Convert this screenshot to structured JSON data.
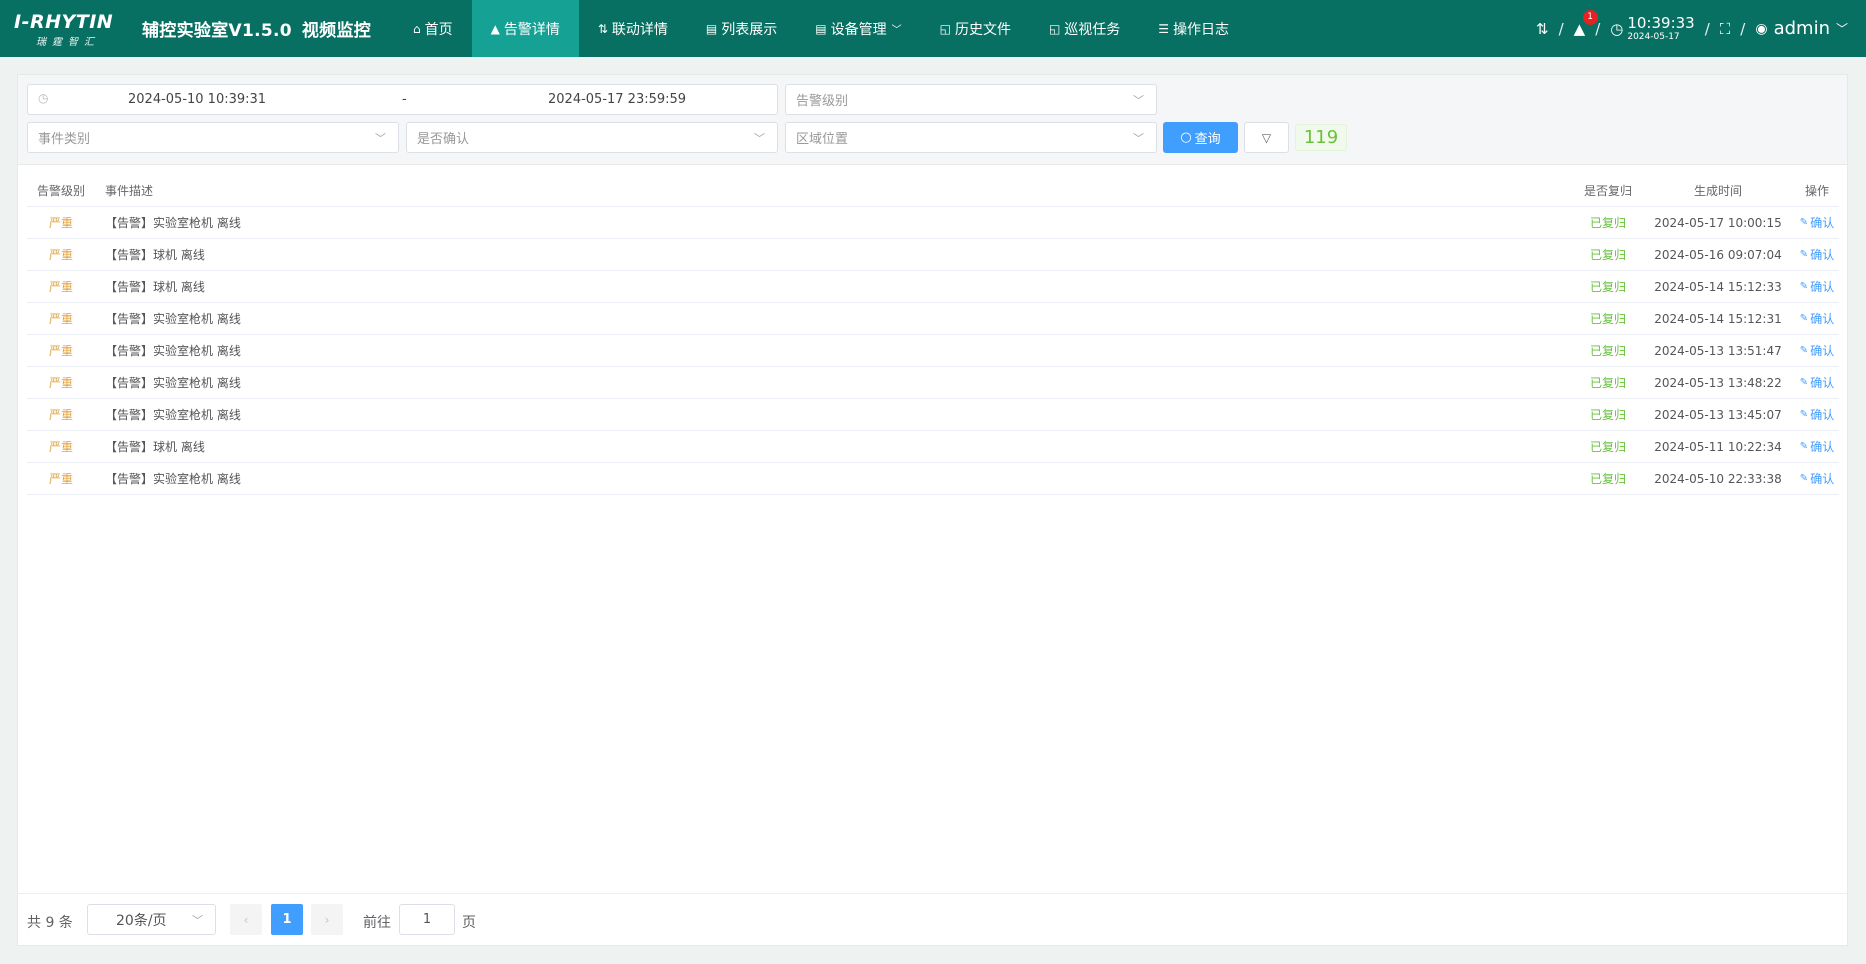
{
  "nav": {
    "logo_main": "I-RHYTIN",
    "logo_sub": "瑞霆智汇",
    "app_title": "辅控实验室V1.5.0",
    "app_subtitle": "视频监控",
    "items": [
      {
        "label": "首页",
        "icon": "home-icon",
        "glyph": "⌂"
      },
      {
        "label": "告警详情",
        "icon": "warning-icon",
        "glyph": "▲"
      },
      {
        "label": "联动详情",
        "icon": "link-icon",
        "glyph": "⇅"
      },
      {
        "label": "列表展示",
        "icon": "list-icon",
        "glyph": "▤"
      },
      {
        "label": "设备管理",
        "icon": "device-icon",
        "glyph": "▤"
      },
      {
        "label": "历史文件",
        "icon": "file-icon",
        "glyph": "◱"
      },
      {
        "label": "巡视任务",
        "icon": "task-icon",
        "glyph": "◱"
      },
      {
        "label": "操作日志",
        "icon": "log-icon",
        "glyph": "☰"
      }
    ],
    "alarm_count": "1",
    "time": "10:39:33",
    "date": "2024-05-17",
    "sep": "/",
    "username": "admin"
  },
  "filters": {
    "start_date": "2024-05-10 10:39:31",
    "dash": "-",
    "end_date": "2024-05-17 23:59:59",
    "alarm_level_placeholder": "告警级别",
    "event_type_placeholder": "事件类别",
    "confirmed_placeholder": "是否确认",
    "area_placeholder": "区域位置",
    "query_label": "查询",
    "count": "119"
  },
  "table": {
    "headers": {
      "level": "告警级别",
      "desc": "事件描述",
      "recovered": "是否复归",
      "time": "生成时间",
      "op": "操作"
    },
    "rows": [
      {
        "level": "严重",
        "desc": "【告警】实验室枪机 离线",
        "recovered": "已复归",
        "time": "2024-05-17 10:00:15",
        "op": "确认"
      },
      {
        "level": "严重",
        "desc": "【告警】球机 离线",
        "recovered": "已复归",
        "time": "2024-05-16 09:07:04",
        "op": "确认"
      },
      {
        "level": "严重",
        "desc": "【告警】球机 离线",
        "recovered": "已复归",
        "time": "2024-05-14 15:12:33",
        "op": "确认"
      },
      {
        "level": "严重",
        "desc": "【告警】实验室枪机 离线",
        "recovered": "已复归",
        "time": "2024-05-14 15:12:31",
        "op": "确认"
      },
      {
        "level": "严重",
        "desc": "【告警】实验室枪机 离线",
        "recovered": "已复归",
        "time": "2024-05-13 13:51:47",
        "op": "确认"
      },
      {
        "level": "严重",
        "desc": "【告警】实验室枪机 离线",
        "recovered": "已复归",
        "time": "2024-05-13 13:48:22",
        "op": "确认"
      },
      {
        "level": "严重",
        "desc": "【告警】实验室枪机 离线",
        "recovered": "已复归",
        "time": "2024-05-13 13:45:07",
        "op": "确认"
      },
      {
        "level": "严重",
        "desc": "【告警】球机 离线",
        "recovered": "已复归",
        "time": "2024-05-11 10:22:34",
        "op": "确认"
      },
      {
        "level": "严重",
        "desc": "【告警】实验室枪机 离线",
        "recovered": "已复归",
        "time": "2024-05-10 22:33:38",
        "op": "确认"
      }
    ]
  },
  "pager": {
    "total": "共 9 条",
    "page_size": "20条/页",
    "current_page": "1",
    "goto_label": "前往",
    "goto_value": "1",
    "page_unit": "页"
  },
  "colors": {
    "navbar": "#087062",
    "nav_active": "#15a295",
    "primary": "#409eff",
    "severity": "#e6a23c",
    "recovered": "#67c23a"
  }
}
